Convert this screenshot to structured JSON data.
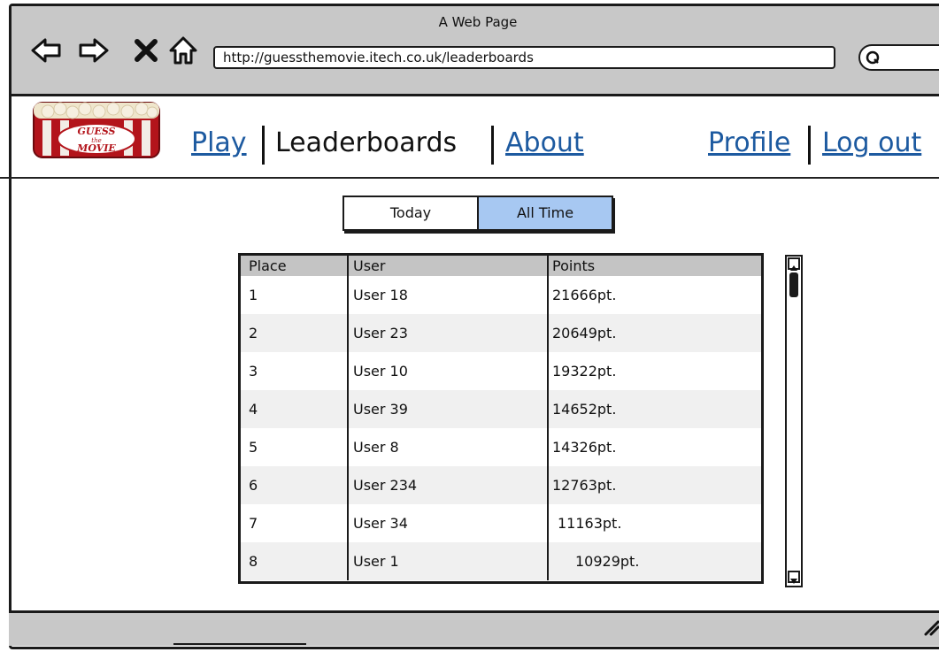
{
  "window": {
    "title": "A Web Page"
  },
  "toolbar": {
    "back_icon": "back-arrow-icon",
    "forward_icon": "forward-arrow-icon",
    "stop_icon": "close-icon",
    "home_icon": "home-icon",
    "url": "http://guessthemovie.itech.co.uk/leaderboards",
    "search_icon": "search-icon"
  },
  "logo": {
    "text_top": "GUESS",
    "text_mid": "the",
    "text_bottom": "MOVIE"
  },
  "nav": {
    "play": "Play",
    "leaderboards": "Leaderboards",
    "about": "About",
    "profile": "Profile",
    "logout": "Log out"
  },
  "segment": {
    "today": "Today",
    "all_time": "All Time",
    "selected": "All Time"
  },
  "table": {
    "headers": [
      "Place",
      "User",
      "Points"
    ],
    "rows": [
      [
        "1",
        "User 18",
        "21666pt."
      ],
      [
        "2",
        "User 23",
        "20649pt."
      ],
      [
        "3",
        "User 10",
        "19322pt."
      ],
      [
        "4",
        "User 39",
        "14652pt."
      ],
      [
        "5",
        "User 8",
        "14326pt."
      ],
      [
        "6",
        "User 234",
        "12763pt."
      ],
      [
        "7",
        "User 34",
        "11163pt."
      ],
      [
        "8",
        "User 1",
        "10929pt."
      ]
    ]
  },
  "colors": {
    "link": "#1d5aa0",
    "selected_segment": "#a7c8f2",
    "chrome": "#c8c8c8"
  }
}
